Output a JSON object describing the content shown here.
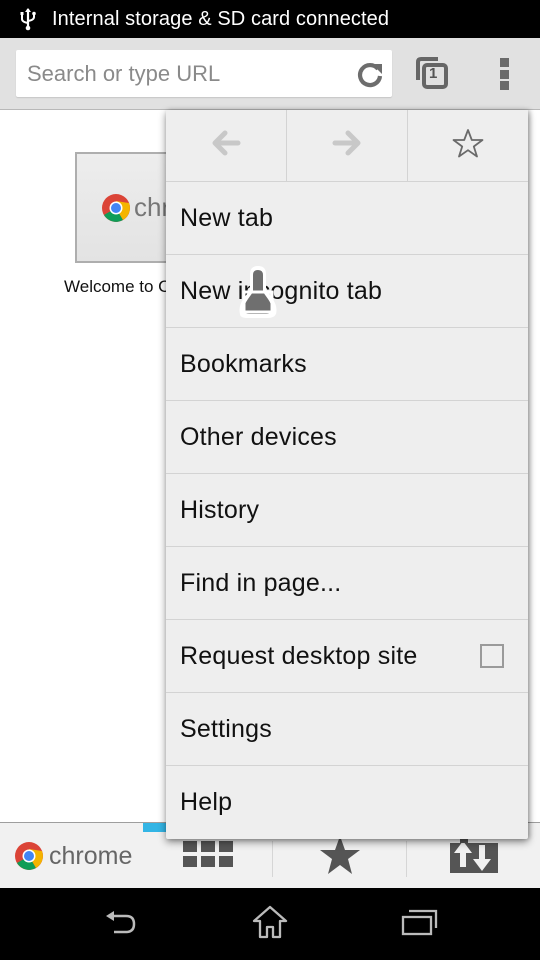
{
  "status_bar": {
    "icon": "usb-icon",
    "notification_text": "Internal storage & SD card connected"
  },
  "toolbar": {
    "omnibox_placeholder": "Search or type URL",
    "omnibox_value": "",
    "reload_icon": "reload-icon",
    "tab_count": "1",
    "menu_icon": "overflow-menu-icon"
  },
  "page": {
    "promo_brand": "chrome",
    "welcome_text": "Welcome to Chrome"
  },
  "menu": {
    "nav_buttons": [
      {
        "name": "back",
        "icon": "back-arrow-icon",
        "enabled": false
      },
      {
        "name": "forward",
        "icon": "forward-arrow-icon",
        "enabled": false
      },
      {
        "name": "bookmark",
        "icon": "star-outline-icon",
        "enabled": true
      }
    ],
    "items": [
      {
        "label": "New tab"
      },
      {
        "label": "New incognito tab"
      },
      {
        "label": "Bookmarks"
      },
      {
        "label": "Other devices"
      },
      {
        "label": "History"
      },
      {
        "label": "Find in page..."
      },
      {
        "label": "Request desktop site",
        "checkbox": true,
        "checked": false
      },
      {
        "label": "Settings"
      },
      {
        "label": "Help"
      }
    ]
  },
  "bottom_bar": {
    "brand": "chrome",
    "buttons": [
      {
        "name": "most-visited",
        "icon": "grid-icon"
      },
      {
        "name": "bookmarks",
        "icon": "star-filled-icon"
      },
      {
        "name": "other-devices",
        "icon": "sync-devices-icon"
      }
    ],
    "accent_color": "#33b5e5"
  },
  "nav_bar": {
    "buttons": [
      {
        "name": "back",
        "icon": "nav-back-icon"
      },
      {
        "name": "home",
        "icon": "nav-home-icon"
      },
      {
        "name": "recents",
        "icon": "nav-recents-icon"
      }
    ]
  }
}
